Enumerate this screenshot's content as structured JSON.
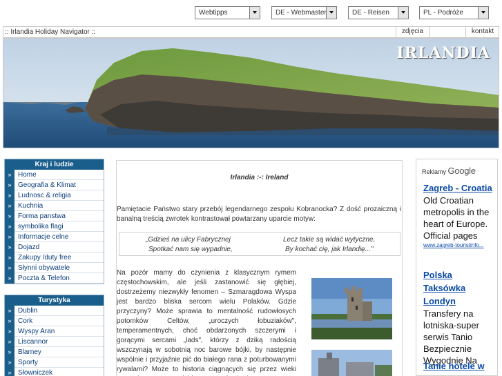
{
  "top_selects": [
    {
      "label": "Webtipps"
    },
    {
      "label": "DE - Webmaster"
    },
    {
      "label": "DE - Reisen"
    },
    {
      "label": "PL - Podróże"
    }
  ],
  "nav": {
    "title": ":: Irlandia Holiday Navigator ::",
    "links": [
      {
        "label": "zdjęcia"
      },
      {
        "label": ""
      },
      {
        "label": "kontakt"
      }
    ]
  },
  "hero": {
    "title": "IRLANDIA"
  },
  "sidebar": {
    "box1": {
      "title": "Kraj i ludzie",
      "items": [
        {
          "label": "Home"
        },
        {
          "label": "Geografia & Klimat"
        },
        {
          "label": "Ludnosc & religia"
        },
        {
          "label": "Kuchnia"
        },
        {
          "label": "Forma panstwa"
        },
        {
          "label": "symbolika flagi"
        },
        {
          "label": "Informacje celne"
        },
        {
          "label": "Dojazd"
        },
        {
          "label": "Zakupy /duty free"
        },
        {
          "label": "Słynni obywatele"
        },
        {
          "label": "Poczta & Telefon"
        }
      ]
    },
    "box2": {
      "title": "Turystyka",
      "items": [
        {
          "label": "Dublin"
        },
        {
          "label": "Cork"
        },
        {
          "label": "Wyspy Aran"
        },
        {
          "label": "Liscannor"
        },
        {
          "label": "Blarney"
        },
        {
          "label": "Sporty"
        },
        {
          "label": "Słowniczek"
        }
      ]
    },
    "bullet": "»"
  },
  "content": {
    "title": "Irlandia :-: Ireland",
    "intro": "Pamiętacie Państwo stary przebój legendarnego zespołu Kobranocka? Z dość prozaiczną i banalną treścią zwrotek kontrastował powtarzany uparcie motyw:",
    "quote": {
      "l1": "„Gdzieś na ulicy Fabrycznej",
      "r1": "Lecz takie są widać wytyczne,",
      "l2": "Spotkać nam się wypadnie,",
      "r2": "By kochać cię, jak Irlandię...\""
    },
    "paragraph": "Na pozór mamy do czynienia z klasycznym rymem częstochowskim, ale jeśli zastanowić się głębiej, dostrzeżemy niezwykły fenomen – Szmaragdowa Wyspa jest bardzo bliska sercom wielu Polaków. Gdzie przyczyny? Może sprawia to mentalność rudowłosych potomków Celtów, „uroczych łobuziaków\", temperamentnych, choć obdarzonych szczerymi i gorącymi sercami „lads\", którzy z dziką radością wszczynają w sobotnią noc barowe bójki, by następnie wspólnie i przyjaźnie pić do białego rana z poturbowanymi rywalami? Może to historia ciągnących się przez wieki marzeń o suwerenności i znaczona krwią droga"
  },
  "ads": {
    "header_prefix": "Reklamy",
    "header_brand": "Google",
    "items": [
      {
        "title": "Zagreb - Croatia",
        "text": "Old Croatian metropolis in the heart of Europe. Official pages",
        "url": "www.zagreb-touristinfo..."
      },
      {
        "title": "Polska Taksówka Londyn",
        "text": "Transfery na lotniska-super serwis Tanio Bezpiecznie Wygodnie Na",
        "url": ""
      },
      {
        "title": "Tanie hotele w",
        "text": "",
        "url": ""
      }
    ]
  }
}
